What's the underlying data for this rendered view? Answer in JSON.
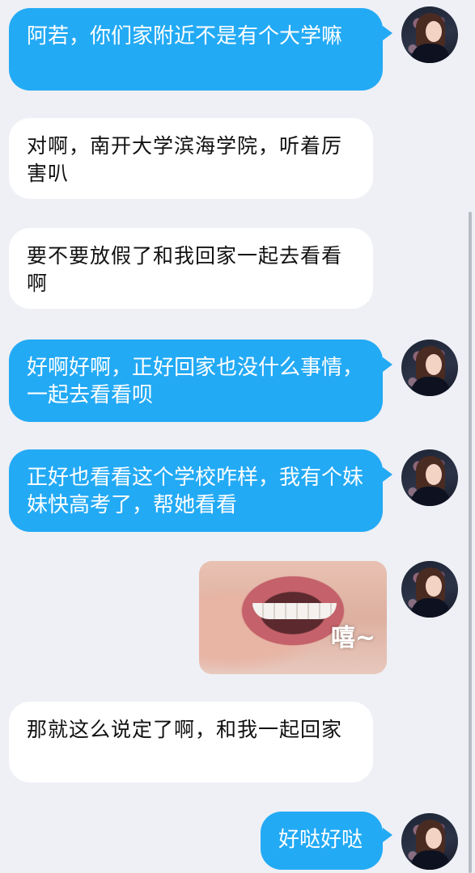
{
  "messages": [
    {
      "side": "out",
      "text": "阿若，你们家附近不是有个大学嘛"
    },
    {
      "side": "in",
      "text": "对啊，南开大学滨海学院，听着厉害叭"
    },
    {
      "side": "in",
      "text": "要不要放假了和我回家一起去看看啊"
    },
    {
      "side": "out",
      "text": "好啊好啊，正好回家也没什么事情，一起去看看呗"
    },
    {
      "side": "out",
      "text": "正好也看看这个学校咋样，我有个妹妹快高考了，帮她看看"
    },
    {
      "side": "out",
      "type": "image",
      "caption": "嘻~"
    },
    {
      "side": "in",
      "text": "那就这么说定了啊，和我一起回家"
    },
    {
      "side": "out",
      "text": "好哒好哒"
    }
  ],
  "colors": {
    "background": "#eef0f5",
    "outgoing_bubble": "#23aaf5",
    "incoming_bubble": "#ffffff"
  },
  "icons": {
    "avatar": "avatar-girl-icon"
  }
}
